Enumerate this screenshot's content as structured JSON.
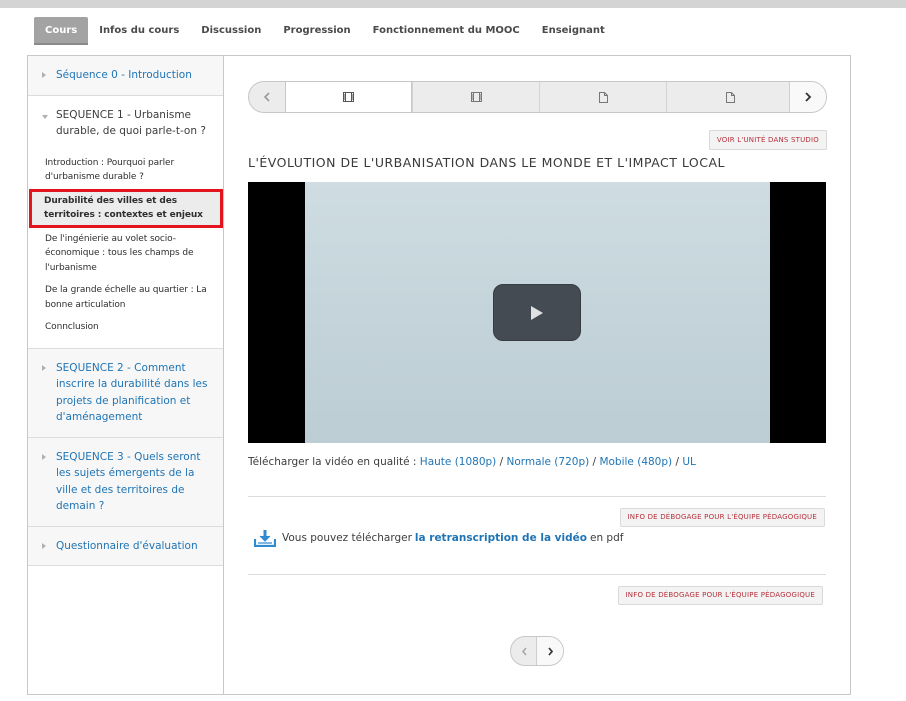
{
  "nav": {
    "tabs": [
      "Cours",
      "Infos du cours",
      "Discussion",
      "Progression",
      "Fonctionnement du MOOC",
      "Enseignant"
    ],
    "active_tab": "Cours"
  },
  "sidebar": {
    "chapters": [
      {
        "title": "Séquence 0 - Introduction"
      },
      {
        "title": "SEQUENCE 1 - Urbanisme durable, de quoi parle-t-on ?"
      },
      {
        "title": "SEQUENCE 2 - Comment inscrire la durabilité dans les projets de planification et d'aménagement"
      },
      {
        "title": "SEQUENCE 3 - Quels seront les sujets émergents de la ville et des territoires de demain ?"
      },
      {
        "title": "Questionnaire d'évaluation"
      }
    ],
    "sequence1_items": [
      "Introduction : Pourquoi parler d'urbanisme durable ?",
      "Durabilité des villes et des territoires : contextes et enjeux",
      "De l'ingénierie au volet socio-économique : tous les champs de l'urbanisme",
      "De la grande échelle au quartier : La bonne articulation",
      "Connclusion"
    ]
  },
  "sequence_nav": {
    "units": [
      {
        "icon": "video-icon",
        "active": true
      },
      {
        "icon": "video-icon",
        "active": false
      },
      {
        "icon": "document-icon",
        "active": false
      },
      {
        "icon": "document-icon",
        "active": false
      }
    ]
  },
  "content": {
    "studio_button": "VOIR L'UNITÉ DANS STUDIO",
    "unit_title": "L'ÉVOLUTION DE L'URBANISATION DANS LE MONDE ET L'IMPACT LOCAL",
    "download": {
      "prefix": "Télécharger la vidéo en qualité :",
      "links": [
        "Haute (1080p)",
        "Normale (720p)",
        "Mobile (480p)",
        "UL"
      ],
      "separator": "/"
    },
    "debug_button": "INFO DE DÉBOGAGE POUR L'ÉQUIPE PÉDAGOGIQUE",
    "transcript": {
      "prefix": "Vous pouvez télécharger",
      "link": "la retranscription de la vidéo",
      "suffix": "en pdf"
    }
  },
  "colors": {
    "link": "#1f74b5",
    "highlight_border": "#e3141d",
    "debug_text": "#b5303a",
    "active_tab_bg": "#a3a3a3"
  }
}
